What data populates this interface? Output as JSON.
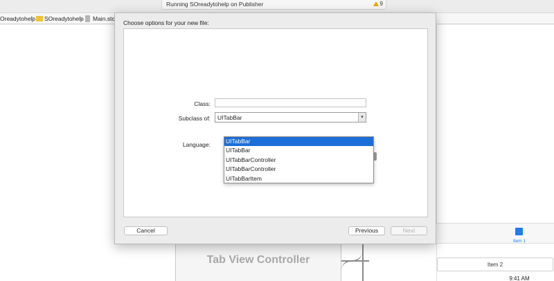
{
  "activity": {
    "status": "Running SOreadytohelp on Publisher",
    "warning_count": "9"
  },
  "jumpbar": {
    "crumb_project": "Oreadytohelp",
    "crumb_group": "SOreadytohelp",
    "crumb_file": "Main.stor"
  },
  "sheet": {
    "title": "Choose options for your new file:",
    "class_label": "Class:",
    "class_value": "",
    "subclass_label": "Subclass of:",
    "subclass_value": "UITabBar",
    "language_label": "Language:",
    "suggestions": [
      "UITabBar",
      "UITabBar",
      "UITabBarController",
      "UITabBarController",
      "UITabBarItem"
    ],
    "selected_index": 0,
    "cancel_label": "Cancel",
    "previous_label": "Previous",
    "next_label": "Next"
  },
  "storyboard": {
    "tab_view_controller": "Tab View Controller",
    "item1_label": "Item 1",
    "item2_label": "Item 2",
    "time": "9:41 AM"
  },
  "colors": {
    "accent": "#1c6ed8",
    "tab_item": "#1e7bf0",
    "warning": "#e6a800"
  }
}
